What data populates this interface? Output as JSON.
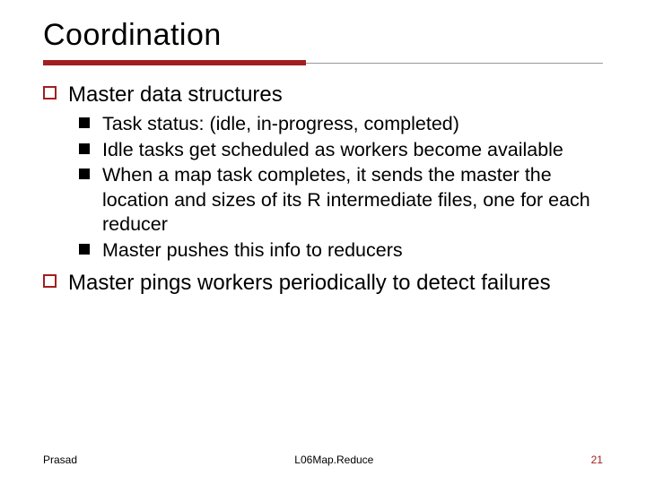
{
  "title": "Coordination",
  "outline": {
    "item1": "Master data structures",
    "sub": {
      "a": "Task status: (idle, in-progress, completed)",
      "b": "Idle tasks get scheduled as workers become available",
      "c": "When a map task completes, it sends the master the location and sizes of its R intermediate files, one for each reducer",
      "d": "Master pushes this info to reducers"
    },
    "item2": "Master pings workers periodically to detect failures"
  },
  "footer": {
    "author": "Prasad",
    "deck": "L06Map.Reduce",
    "page": "21"
  }
}
